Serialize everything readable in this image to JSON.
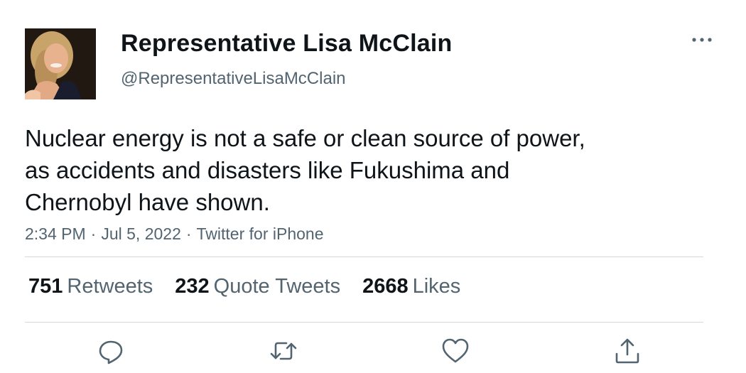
{
  "tweet": {
    "author": {
      "display_name": "Representative Lisa McClain",
      "handle": "@RepresentativeLisaMcClain",
      "avatar_icon": "profile-photo"
    },
    "text_lines": [
      "Nuclear energy is not a safe or clean source of power,",
      "as accidents and disasters like Fukushima and",
      "Chernobyl have shown."
    ],
    "meta": {
      "time": "2:34 PM",
      "separator": "·",
      "date": "Jul 5, 2022",
      "source": "Twitter for iPhone"
    },
    "stats": {
      "retweets": {
        "count": "751",
        "label": "Retweets"
      },
      "quote_tweets": {
        "count": "232",
        "label": "Quote Tweets"
      },
      "likes": {
        "count": "2668",
        "label": "Likes"
      }
    },
    "actions": [
      {
        "name": "reply",
        "icon": "reply-icon"
      },
      {
        "name": "retweet",
        "icon": "retweet-icon"
      },
      {
        "name": "like",
        "icon": "heart-icon"
      },
      {
        "name": "share",
        "icon": "share-icon"
      }
    ],
    "more_icon": "more-icon"
  },
  "colors": {
    "text_primary": "#0f1419",
    "text_secondary": "#536471",
    "divider": "#cfd9de",
    "background": "#ffffff"
  }
}
